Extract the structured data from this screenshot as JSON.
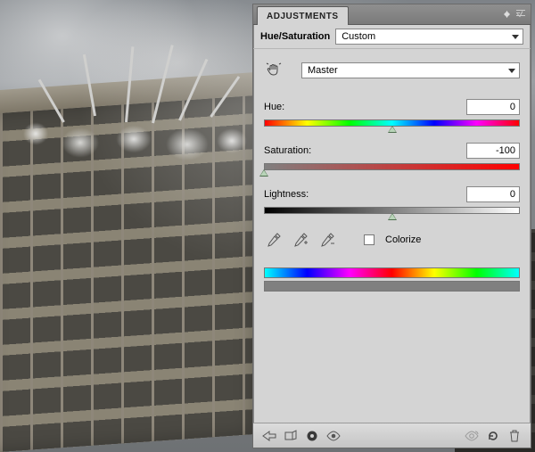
{
  "panel": {
    "tab_label": "ADJUSTMENTS",
    "title": "Hue/Saturation",
    "preset": "Custom",
    "channel": "Master",
    "labels": {
      "hue": "Hue:",
      "saturation": "Saturation:",
      "lightness": "Lightness:",
      "colorize": "Colorize"
    },
    "values": {
      "hue": "0",
      "saturation": "-100",
      "lightness": "0"
    },
    "slider_pos": {
      "hue": 50,
      "saturation": 0,
      "lightness": 50
    },
    "colorize": false,
    "icons": {
      "collapse": "collapse",
      "menu": "menu",
      "targeted": "targeted-adjustment",
      "eyedropper": "eyedropper",
      "eyedropper_plus": "eyedropper-plus",
      "eyedropper_minus": "eyedropper-minus",
      "back": "back",
      "expand": "expand-view",
      "clip": "clip-to-layer",
      "visibility": "visibility",
      "prev_state": "view-previous-state",
      "reset": "reset",
      "trash": "delete"
    }
  }
}
